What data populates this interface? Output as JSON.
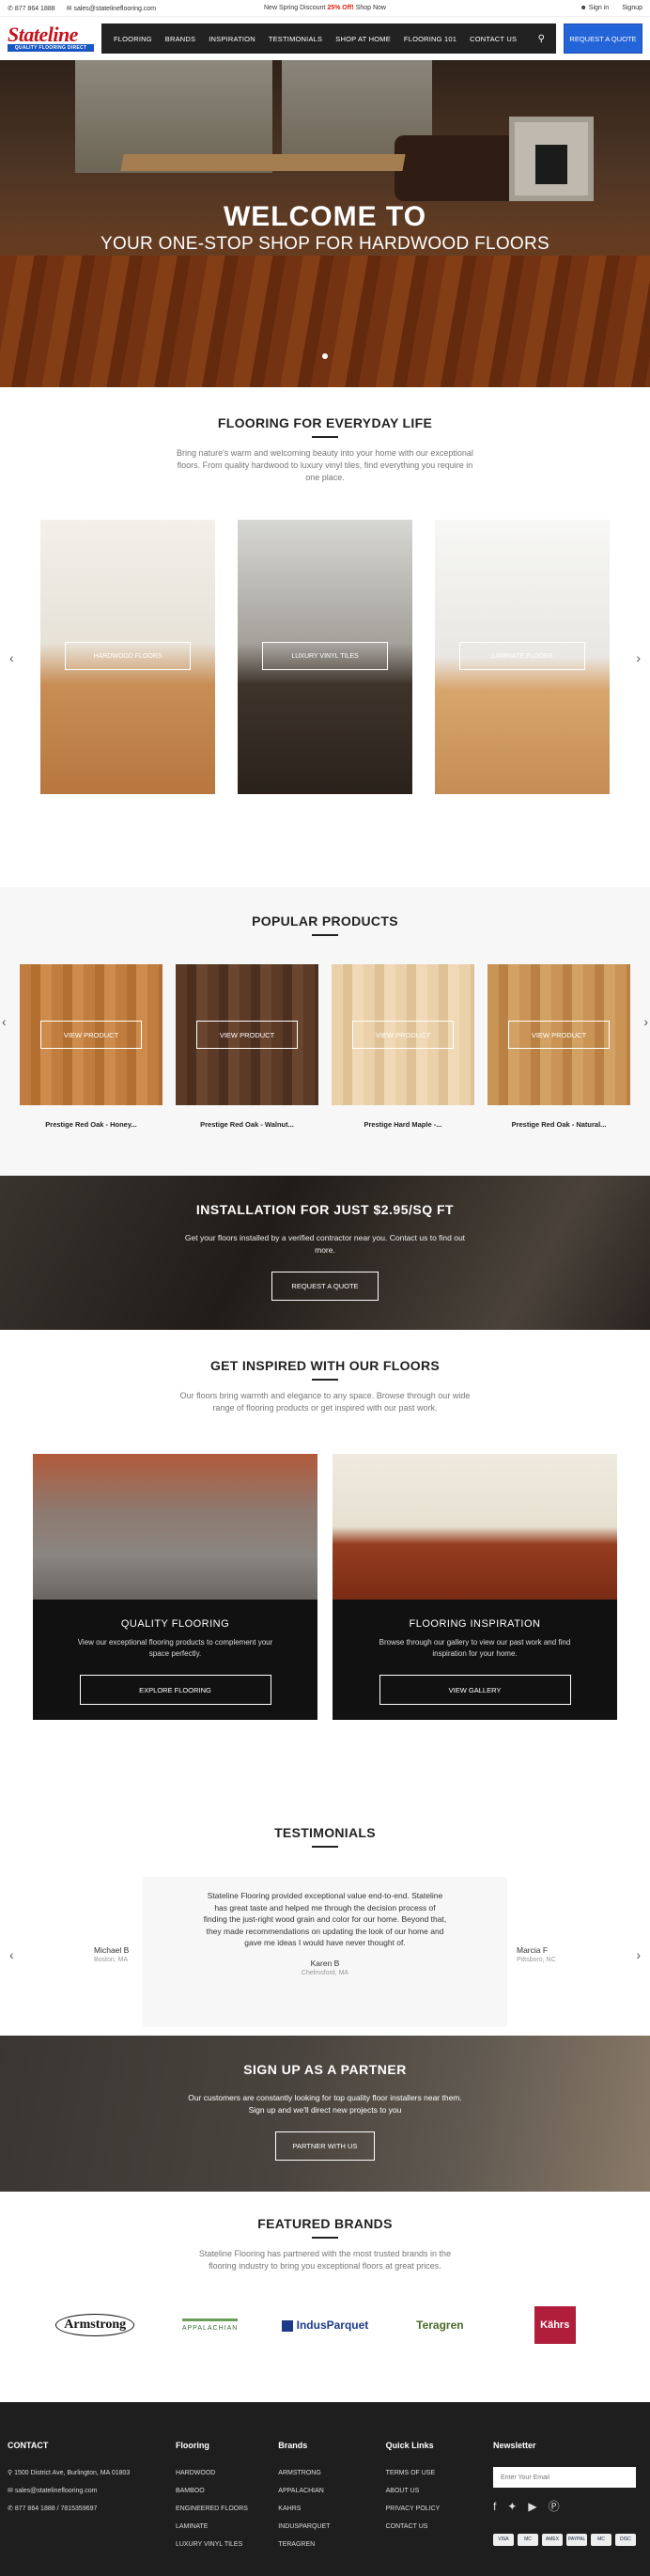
{
  "topbar": {
    "phone": "877 864 1888",
    "email": "sales@statelineflooring.com",
    "promo_prefix": "New Spring Discount",
    "promo_highlight": "25% Off!",
    "promo_suffix": "Shop Now",
    "signin": "Sign in",
    "signup": "Signup"
  },
  "header": {
    "logo_text": "Stateline",
    "logo_tagline": "QUALITY FLOORING DIRECT",
    "nav": [
      "FLOORING",
      "BRANDS",
      "INSPIRATION",
      "TESTIMONIALS",
      "SHOP AT HOME",
      "FLOORING 101",
      "CONTACT US"
    ],
    "quote_button": "REQUEST A QUOTE"
  },
  "hero": {
    "title": "WELCOME TO",
    "subtitle": "YOUR ONE-STOP SHOP FOR HARDWOOD FLOORS"
  },
  "everyday": {
    "title": "FLOORING FOR EVERYDAY LIFE",
    "text": "Bring nature's warm and welcoming beauty into your home with our exceptional floors. From quality hardwood to luxury vinyl tiles, find everything you require in one place.",
    "cards": [
      "HARDWOOD FLOORS",
      "LUXURY VINYL TILES",
      "LAMINATE FLOORS"
    ]
  },
  "popular": {
    "title": "POPULAR PRODUCTS",
    "button": "VIEW PRODUCT",
    "products": [
      "Prestige Red Oak - Honey...",
      "Prestige Red Oak - Walnut...",
      "Prestige Hard Maple -...",
      "Prestige Red Oak - Natural..."
    ]
  },
  "install": {
    "title": "INSTALLATION FOR JUST $2.95/SQ FT",
    "text": "Get your floors installed by a verified contractor near you. Contact us to find out more.",
    "button": "REQUEST A QUOTE"
  },
  "inspired": {
    "title": "GET INSPIRED WITH OUR FLOORS",
    "text": "Our floors bring warmth and elegance to any space. Browse through our wide range of flooring products or get inspired with our past work.",
    "cards": [
      {
        "title": "QUALITY FLOORING",
        "text": "View our exceptional flooring products to complement your space perfectly.",
        "button": "EXPLORE FLOORING"
      },
      {
        "title": "FLOORING INSPIRATION",
        "text": "Browse through our gallery to view our past work and find inspiration for your home.",
        "button": "VIEW GALLERY"
      }
    ]
  },
  "testimonials": {
    "title": "TESTIMONIALS",
    "quote": "Stateline Flooring provided exceptional value end-to-end. Stateline has great taste and helped me through the decision process of finding the just-right wood grain and color for our home. Beyond that, they made recommendations on updating the look of our home and gave me ideas I would have never thought of.",
    "name": "Karen B",
    "location": "Chelmsford, MA",
    "left_name": "Michael B",
    "left_location": "Boston, MA",
    "right_name": "Marcia F",
    "right_location": "Pittsboro, NC"
  },
  "partner": {
    "title": "SIGN UP AS A PARTNER",
    "text": "Our customers are constantly looking for top quality floor installers near them. Sign up and we'll direct new projects to you",
    "button": "PARTNER WITH US"
  },
  "brands": {
    "title": "FEATURED BRANDS",
    "text": "Stateline Flooring has partnered with the most trusted brands in the flooring industry to bring you exceptional floors at great prices.",
    "logos": [
      "Armstrong",
      "APPALACHIAN",
      "IndusParquet",
      "Teragren",
      "Kährs"
    ]
  },
  "footer": {
    "contact_title": "CONTACT",
    "address": "1500 District Ave, Burlington, MA 01803",
    "email": "sales@statelineflooring.com",
    "phone": "877 864 1888 / 7815359697",
    "flooring_title": "Flooring",
    "flooring": [
      "HARDWOOD",
      "BAMBOO",
      "ENGINEERED FLOORS",
      "LAMINATE",
      "LUXURY VINYL TILES"
    ],
    "brands_title": "Brands",
    "brands": [
      "ARMSTRONG",
      "APPALACHIAN",
      "KAHRS",
      "INDUSPARQUET",
      "TERAGREN"
    ],
    "quick_title": "Quick Links",
    "quick": [
      "TERMS OF USE",
      "ABOUT US",
      "PRIVACY POLICY",
      "CONTACT US"
    ],
    "newsletter_title": "Newsletter",
    "newsletter_placeholder": "Enter Your Email",
    "payments": [
      "VISA",
      "MC",
      "AMEX",
      "PAYPAL",
      "MC",
      "DISC"
    ]
  },
  "colors": {
    "accent": "#2364d8",
    "brand_red": "#c5121c",
    "footer_bg": "#1e1e1e"
  }
}
